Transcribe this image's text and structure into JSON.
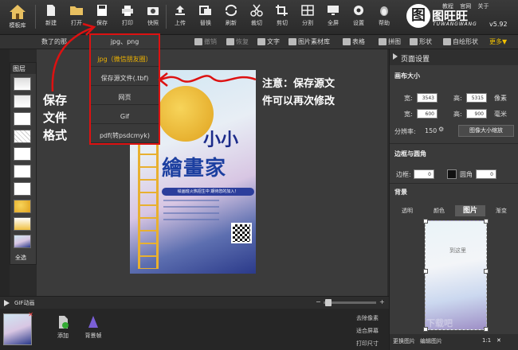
{
  "toolbar": {
    "home": "模板库",
    "items": [
      "新建",
      "打开",
      "保存",
      "打印",
      "快照",
      "上传",
      "替换",
      "刷新",
      "裁切",
      "剪切",
      "分割",
      "全屏",
      "设置",
      "帮助"
    ]
  },
  "logo": {
    "mark": "图",
    "name": "图旺旺",
    "sub": "TUWANGWANG",
    "version": "v5.92"
  },
  "top_links": [
    "教程",
    "官网",
    "关于"
  ],
  "toolbar2": {
    "left": "数了的那",
    "right_items": [
      "撤销",
      "恢复",
      "文字",
      "图片素材库",
      "表格",
      "拼图",
      "形状",
      "自绘形状"
    ],
    "more": "更多▼"
  },
  "layers": {
    "title": "图层",
    "select_all": "全选"
  },
  "save_menu": {
    "items": [
      "jpg、png",
      "jpg（微信朋友圈）",
      "保存源文件(.tbf)",
      "网页",
      "Gif",
      "pdf(转psdcmyk)"
    ]
  },
  "annotations": {
    "left_lines": [
      "保存",
      "文件",
      "格式"
    ],
    "right_lines": [
      "注意：保存源文",
      "件可以再次修改"
    ]
  },
  "poster": {
    "title1": "小小",
    "title2": "繪畫家",
    "banner": "绘画班火热招生中 期待您的加入！"
  },
  "gif_bar": {
    "label": "GIF动画"
  },
  "bottom": {
    "buttons": [
      "添加",
      "背景帧"
    ],
    "side_links": [
      "去除像素",
      "适合屏幕",
      "打印尺寸"
    ]
  },
  "right_panel": {
    "title": "页面设置",
    "canvas_size": "画布大小",
    "width_label": "宽:",
    "height_label": "高:",
    "px_width": "3543",
    "px_height": "5315",
    "px_unit": "像素",
    "mm_width": "600",
    "mm_height": "900",
    "mm_unit": "毫米",
    "dpi_label": "分辨率:",
    "dpi_value": "150",
    "resize_button": "图像大小缩放",
    "border_section": "边框与圆角",
    "border_label": "边框:",
    "border_value": "0",
    "radius_label": "圆角",
    "radius_value": "0",
    "bg_section": "背景",
    "bg_tabs": [
      "透明",
      "颜色",
      "图片",
      "渐变"
    ],
    "bg_hint": "到这里",
    "bottom_buttons": [
      "更换图片",
      "编辑图片",
      "1:1"
    ]
  },
  "watermark": "下载吧"
}
